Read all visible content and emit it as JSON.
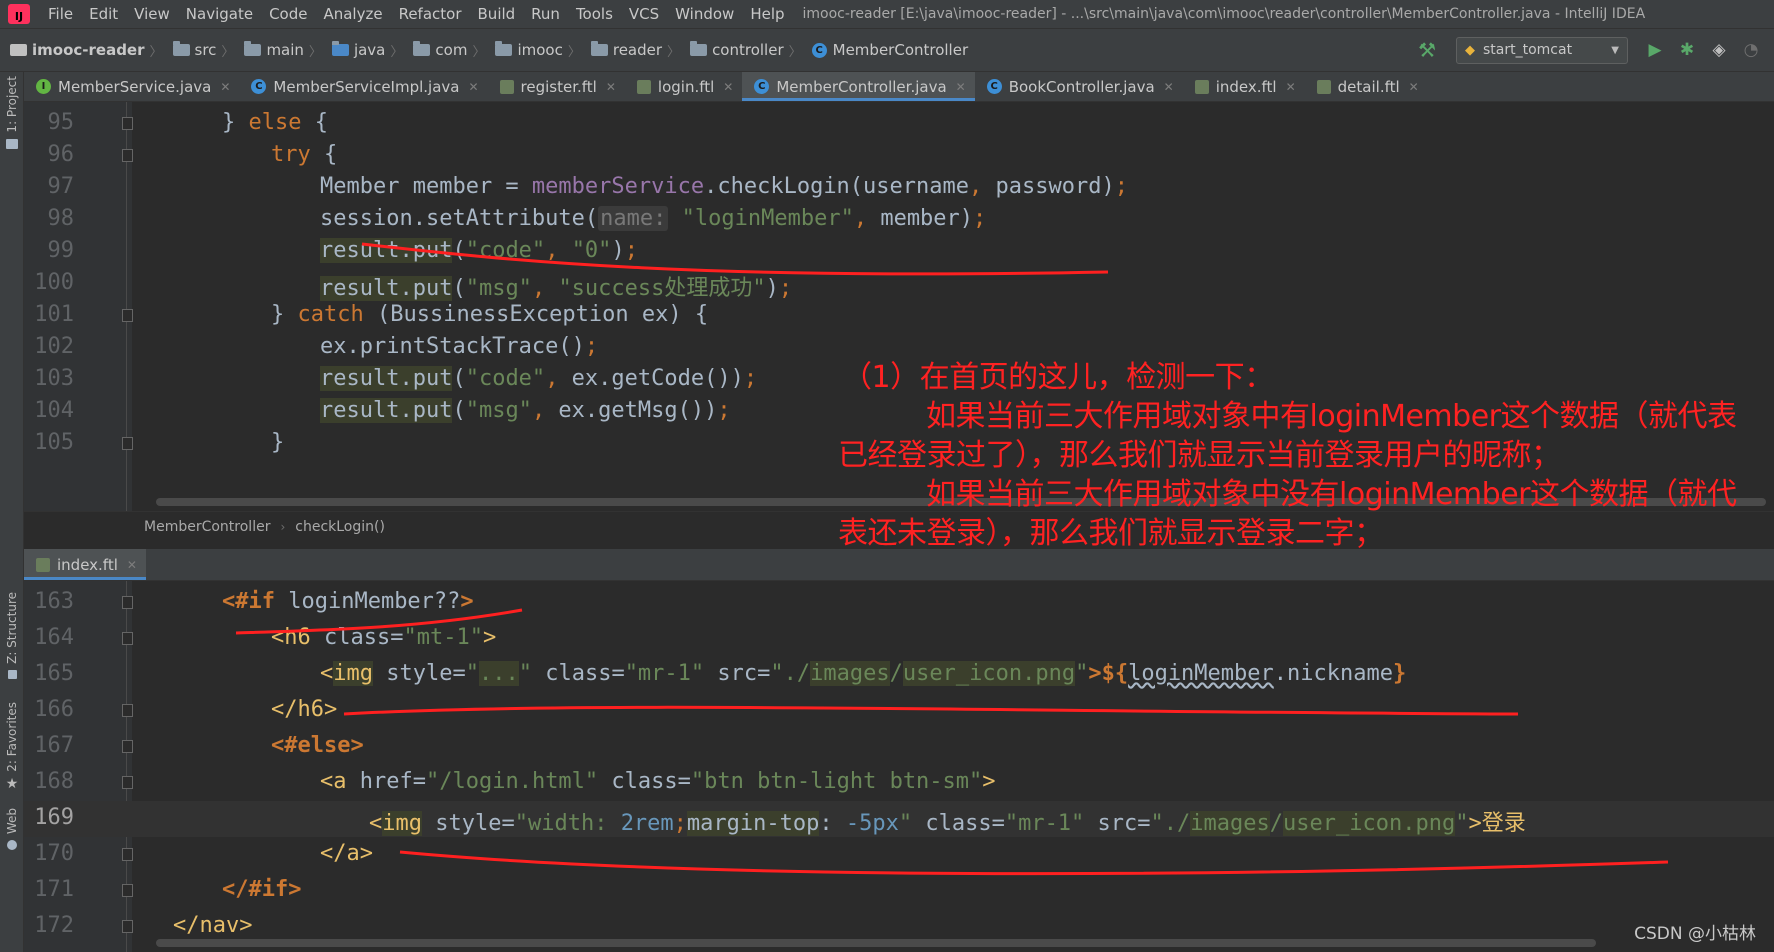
{
  "menubar": {
    "items": [
      "File",
      "Edit",
      "View",
      "Navigate",
      "Code",
      "Analyze",
      "Refactor",
      "Build",
      "Run",
      "Tools",
      "VCS",
      "Window",
      "Help"
    ],
    "window_title": "imooc-reader [E:\\java\\imooc-reader] - ...\\src\\main\\java\\com\\imooc\\reader\\controller\\MemberController.java - IntelliJ IDEA"
  },
  "navbar": {
    "project": "imooc-reader",
    "folders": [
      "src",
      "main",
      "java",
      "com",
      "imooc",
      "reader",
      "controller"
    ],
    "file": "MemberController",
    "run_config": "start_tomcat"
  },
  "left_strip": {
    "project": "1: Project",
    "structure": "Z: Structure",
    "favorites": "2: Favorites",
    "web": "Web"
  },
  "top_tabs": [
    {
      "label": "MemberService.java",
      "icon": "interface-icon"
    },
    {
      "label": "MemberServiceImpl.java",
      "icon": "class-icon"
    },
    {
      "label": "register.ftl",
      "icon": "ftl-icon"
    },
    {
      "label": "login.ftl",
      "icon": "ftl-icon"
    },
    {
      "label": "MemberController.java",
      "icon": "class-icon",
      "active": true
    },
    {
      "label": "BookController.java",
      "icon": "class-icon"
    },
    {
      "label": "index.ftl",
      "icon": "ftl-icon"
    },
    {
      "label": "detail.ftl",
      "icon": "ftl-icon"
    }
  ],
  "code_crumbs": [
    "MemberController",
    "checkLogin()"
  ],
  "bottom_tabs": [
    {
      "label": "index.ftl",
      "icon": "ftl-icon",
      "active": true
    }
  ],
  "top_code": {
    "line_numbers": [
      "95",
      "96",
      "97",
      "98",
      "99",
      "100",
      "101",
      "102",
      "103",
      "104",
      "105"
    ],
    "l95": {
      "a": "} ",
      "b": "else",
      "c": " {"
    },
    "l96": {
      "a": "try",
      "b": " {"
    },
    "l97": {
      "a": "Member member = ",
      "b": "memberService",
      "c": ".checkLogin(username",
      "d": ",",
      "e": " password)",
      "f": ";"
    },
    "l98": {
      "a": "session.setAttribute(",
      "b": "name:",
      "c": "\"loginMember\"",
      "d": ",",
      "e": " member)",
      "f": ";"
    },
    "l99": {
      "a": "result.put",
      "b": "(",
      "c": "\"code\"",
      "d": ",",
      "e": " ",
      "f": "\"0\"",
      "g": ")",
      "h": ";"
    },
    "l100": {
      "a": "result.put",
      "b": "(",
      "c": "\"msg\"",
      "d": ",",
      "e": " ",
      "f": "\"success处理成功\"",
      "g": ")",
      "h": ";"
    },
    "l101": {
      "a": "} ",
      "b": "catch",
      "c": " (BussinessException ex) {"
    },
    "l102": {
      "a": "ex.printStackTrace()",
      "b": ";"
    },
    "l103": {
      "a": "result.put",
      "b": "(",
      "c": "\"code\"",
      "d": ",",
      "e": " ex.getCode())",
      "f": ";"
    },
    "l104": {
      "a": "result.put",
      "b": "(",
      "c": "\"msg\"",
      "d": ",",
      "e": " ex.getMsg())",
      "f": ";"
    },
    "l105": {
      "a": "}"
    }
  },
  "bottom_code": {
    "line_numbers": [
      "163",
      "164",
      "165",
      "166",
      "167",
      "168",
      "169",
      "170",
      "171",
      "172"
    ],
    "l163": {
      "a": "<#if",
      "b": " loginMember??",
      "c": ">"
    },
    "l164": {
      "a": "<h6 ",
      "b": "class=",
      "c": "\"mt-1\"",
      "d": ">"
    },
    "l165": {
      "a": "<",
      "b": "img",
      "c": " style=",
      "d": "\"",
      "e": "...",
      "f": "\"",
      "g": " class=",
      "h": "\"mr-1\"",
      "i": " src=",
      "j": "\"./",
      "k": "images",
      "l": "/",
      "m": "user_icon.png",
      "n": "\"",
      "o": ">${",
      "p": "loginMember",
      "q": ".nickname",
      "r": "}"
    },
    "l166": {
      "a": "</h6>"
    },
    "l167": {
      "a": "<#else>"
    },
    "l168": {
      "a": "<a ",
      "b": "href=",
      "c": "\"/login.html\"",
      "d": " class=",
      "e": "\"btn btn-light btn-sm\"",
      "f": ">"
    },
    "l169": {
      "a": "<",
      "b": "img",
      "c": " style=",
      "d": "\"width: ",
      "e": "2rem",
      "f": ";",
      "g": "margin-top",
      "h": ": ",
      "i": "-5px",
      "j": "\"",
      "k": " class=",
      "l": "\"mr-1\"",
      "m": " src=",
      "n": "\"./",
      "o": "images",
      "p": "/",
      "q": "user_icon.png",
      "r": "\"",
      "s": ">登录"
    },
    "l170": {
      "a": "</a>"
    },
    "l171": {
      "a": "</#if>"
    },
    "l172": {
      "a": "</nav>"
    }
  },
  "annotation": {
    "line1": "（1）在首页的这儿，检测一下：",
    "line2": "如果当前三大作用域对象中有loginMember这个数据（就代表",
    "line3": "已经登录过了），那么我们就显示当前登录用户的昵称；",
    "line4": "如果当前三大作用域对象中没有loginMember这个数据（就代",
    "line5": "表还未登录），那么我们就显示登录二字；",
    "color": "#ff2222"
  },
  "watermark": "CSDN @小枯林",
  "colors": {
    "keyword": "#cc7832",
    "string": "#6a8759",
    "field": "#9876aa",
    "tag": "#e8bf6a",
    "background": "#2b2b2b",
    "accent": "#4a88c7"
  }
}
